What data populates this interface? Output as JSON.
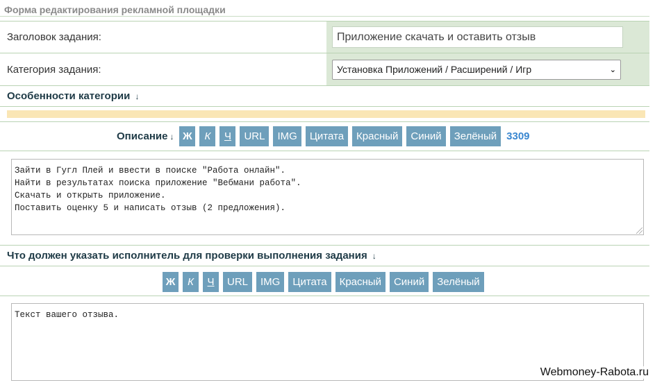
{
  "form_title": "Форма редактирования рекламной площадки",
  "fields": {
    "title_label": "Заголовок задания:",
    "title_value": "Приложение скачать и оставить отзыв",
    "category_label": "Категория задания:",
    "category_value": "Установка Приложений / Расширений / Игр"
  },
  "sections": {
    "features": "Особенности категории",
    "description": "Описание",
    "verify": "Что должен указать исполнитель для проверки выполнения задания",
    "arrow": "↓"
  },
  "toolbar": {
    "bold": "Ж",
    "italic": "К",
    "underline": "Ч",
    "url": "URL",
    "img": "IMG",
    "quote": "Цитата",
    "red": "Красный",
    "blue": "Синий",
    "green": "Зелёный",
    "counter": "3309"
  },
  "description_text": [
    "Зайти в Гугл Плей и ввести в поиске \"Работа онлайн\".",
    "Найти в результатах поиска приложение \"Вебмани работа\".",
    "Скачать и открыть приложение.",
    "Поставить оценку 5 и написать отзыв (2 предложения)."
  ],
  "report_text": "Текст вашего отзыва.",
  "watermark": "Webmoney-Rabota.ru",
  "colors": {
    "button_bg": "#6e9fbb",
    "cell_bg": "#dbe8d6",
    "accent_bar": "#fae6b5",
    "counter": "#3a87d0"
  },
  "icons": {
    "select_arrow": "chevron-down-icon",
    "resize": "resize-grip-icon"
  }
}
